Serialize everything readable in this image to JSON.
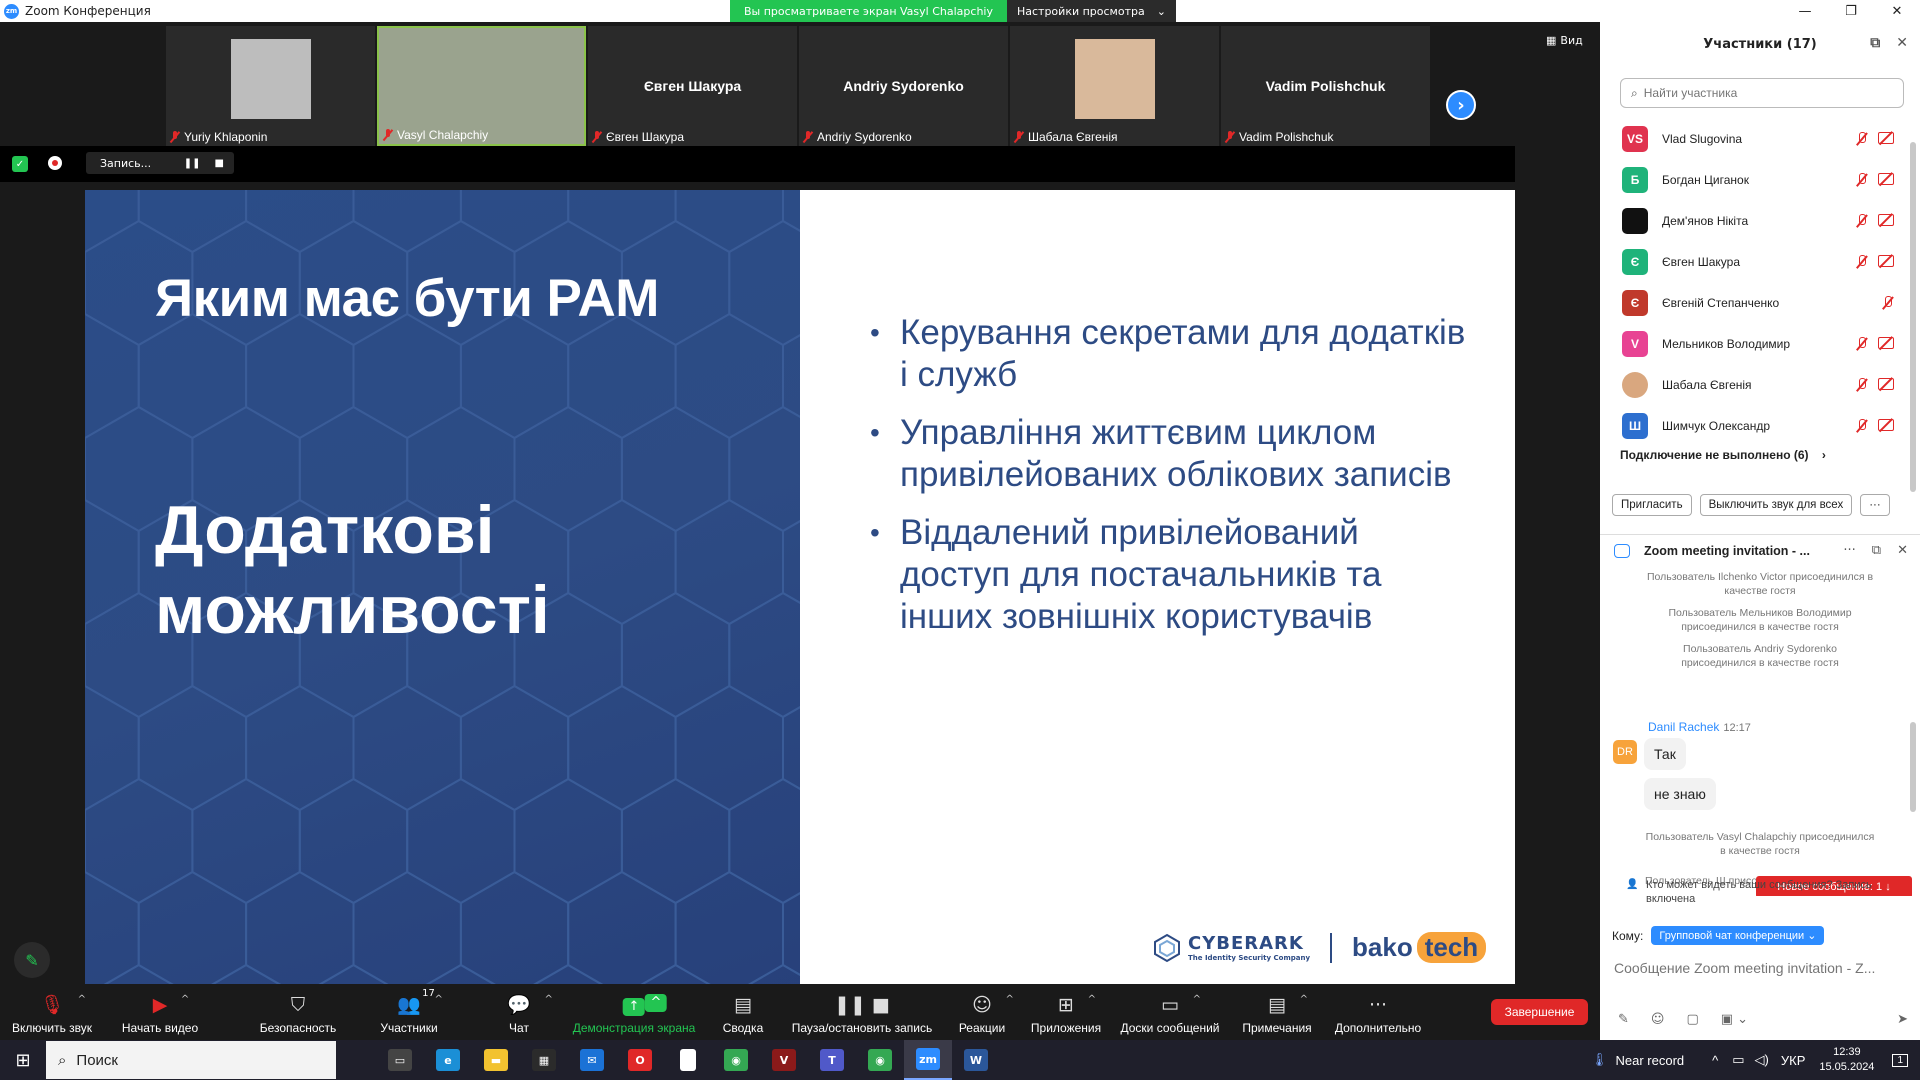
{
  "window": {
    "title": "Zoom Конференция",
    "logo_text": "zm",
    "share_banner": "Вы просматриваете экран Vasyl Chalapchiy",
    "view_settings": "Настройки просмотра",
    "controls": [
      "—",
      "❐",
      "✕"
    ]
  },
  "video_strip": {
    "tiles": [
      {
        "label": "Yuriy Khlaponin",
        "center_name": "",
        "has_photo": true,
        "active": false
      },
      {
        "label": "Vasyl Chalapchiy",
        "center_name": "",
        "has_photo": true,
        "active": true
      },
      {
        "label": "Євген Шакура",
        "center_name": "Євген Шакура",
        "has_photo": false,
        "active": false
      },
      {
        "label": "Andriy Sydorenko",
        "center_name": "Andriy Sydorenko",
        "has_photo": false,
        "active": false
      },
      {
        "label": "Шабала Євгенія",
        "center_name": "",
        "has_photo": true,
        "active": false
      },
      {
        "label": "Vadim Polishchuk",
        "center_name": "Vadim Polishchuk",
        "has_photo": false,
        "active": false
      }
    ],
    "view_label": "Вид"
  },
  "recording": {
    "label": "Запись..."
  },
  "slide": {
    "title": "Яким має бути PAM",
    "subtitle": "Додаткові можливості",
    "bullets": [
      "Керування секретами для додатків і служб",
      "Управління життєвим циклом привілейованих облікових записів",
      "Віддалений привілейований доступ для постачальників та інших зовнішніх користувачів"
    ],
    "logo_cyberark": "CYBERARK",
    "logo_cyberark_tag": "The Identity Security Company",
    "logo_bako": "bako",
    "logo_tech": "tech",
    "colors": {
      "left_bg": "#2d4b84",
      "text": "#2d4b84",
      "accent": "#f7a33b"
    }
  },
  "toolbar": {
    "items": [
      {
        "label": "Включить звук",
        "icon": "mic-off-icon"
      },
      {
        "label": "Начать видео",
        "icon": "video-off-icon"
      },
      {
        "label": "Безопасность",
        "icon": "shield-icon"
      },
      {
        "label": "Участники",
        "icon": "participants-icon",
        "badge": "17"
      },
      {
        "label": "Чат",
        "icon": "chat-icon"
      },
      {
        "label": "Демонстрация экрана",
        "icon": "share-screen-icon"
      },
      {
        "label": "Сводка",
        "icon": "summary-icon"
      },
      {
        "label": "Пауза/остановить запись",
        "icon": "pause-record-icon"
      },
      {
        "label": "Реакции",
        "icon": "reactions-icon"
      },
      {
        "label": "Приложения",
        "icon": "apps-icon"
      },
      {
        "label": "Доски сообщений",
        "icon": "whiteboard-icon"
      },
      {
        "label": "Примечания",
        "icon": "notes-icon"
      },
      {
        "label": "Дополнительно",
        "icon": "more-icon"
      }
    ],
    "end_label": "Завершение"
  },
  "participants": {
    "title": "Участники (17)",
    "search_placeholder": "Найти участника",
    "list": [
      {
        "initials": "VS",
        "name": "Vlad Slugovina",
        "color": "#e0334f",
        "video_off": true
      },
      {
        "initials": "Б",
        "name": "Богдан Циганок",
        "color": "#1fb37a",
        "video_off": true
      },
      {
        "initials": "",
        "name": "Дем'янов Нікіта",
        "color": "#111111",
        "video_off": true
      },
      {
        "initials": "Є",
        "name": "Євген Шакура",
        "color": "#1fb37a",
        "video_off": true
      },
      {
        "initials": "Є",
        "name": "Євгеній Степанченко",
        "color": "#c0392b",
        "video_off": false
      },
      {
        "initials": "V",
        "name": "Мельников Володимир",
        "color": "#e84393",
        "video_off": true
      },
      {
        "initials": "",
        "name": "Шабала Євгенія",
        "color": "#d9a77f",
        "video_off": true
      },
      {
        "initials": "Ш",
        "name": "Шимчук Олександр",
        "color": "#2d6fcf",
        "video_off": true
      }
    ],
    "failed_label": "Подключение не выполнено (6)",
    "invite_label": "Пригласить",
    "mute_all_label": "Выключить звук для всех",
    "more_label": "···"
  },
  "chat": {
    "title": "Zoom meeting invitation - ...",
    "system_messages": [
      "Пользователь Ilchenko Victor присоединился в качестве гостя",
      "Пользователь Мельников Володимир присоединился в качестве гостя",
      "Пользователь Andriy Sydorenko присоединился в качестве гостя"
    ],
    "author": "Danil Rachek",
    "author_initials": "DR",
    "time": "12:17",
    "messages": [
      "Так",
      "не знаю"
    ],
    "after_message": "Пользователь Vasyl Chalapchiy присоединился в качестве гостя",
    "partial_message": "Пользователь Ш присоедин",
    "new_message_badge": "Новое сообщение: 1 ↓",
    "who_sees": "Кто может видеть ваши сообщения? Запись включена",
    "to_label": "Кому:",
    "to_value": "Групповой чат конференции ⌄",
    "input_placeholder": "Сообщение Zoom meeting invitation - Z..."
  },
  "taskbar": {
    "search_label": "Поиск",
    "apps": [
      {
        "name": "task-view",
        "color": "#444",
        "glyph": "▭"
      },
      {
        "name": "edge",
        "color": "#1b8fd6",
        "glyph": "e"
      },
      {
        "name": "explorer",
        "color": "#f2c230",
        "glyph": "▬"
      },
      {
        "name": "store",
        "color": "#2b2b2b",
        "glyph": "▦"
      },
      {
        "name": "mail",
        "color": "#1b72d6",
        "glyph": "✉"
      },
      {
        "name": "opera",
        "color": "#e02828",
        "glyph": "O"
      },
      {
        "name": "file",
        "color": "#ffffff",
        "glyph": ""
      },
      {
        "name": "chrome",
        "color": "#34a853",
        "glyph": "◉"
      },
      {
        "name": "voice",
        "color": "#8b1a1a",
        "glyph": "V"
      },
      {
        "name": "teams",
        "color": "#5059c9",
        "glyph": "T"
      },
      {
        "name": "chrome2",
        "color": "#34a853",
        "glyph": "◉"
      },
      {
        "name": "zoom",
        "color": "#2d8cff",
        "glyph": "zm"
      },
      {
        "name": "word",
        "color": "#2b579a",
        "glyph": "W"
      }
    ],
    "weather": "Near record",
    "lang": "УКР",
    "time": "12:39",
    "date": "15.05.2024",
    "notifications": "1"
  }
}
